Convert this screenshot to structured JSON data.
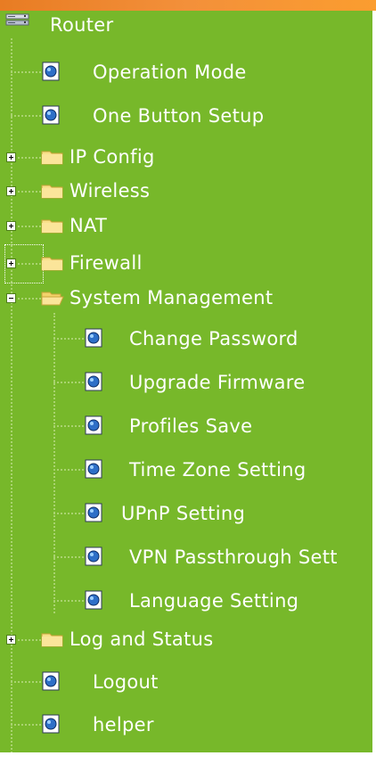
{
  "tree": {
    "root": {
      "label": "Router",
      "icon": "router-icon"
    },
    "items": [
      {
        "label": "Operation Mode",
        "type": "page"
      },
      {
        "label": "One Button Setup",
        "type": "page"
      },
      {
        "label": "IP Config",
        "type": "folder",
        "expanded": false
      },
      {
        "label": "Wireless",
        "type": "folder",
        "expanded": false
      },
      {
        "label": "NAT",
        "type": "folder",
        "expanded": false
      },
      {
        "label": "Firewall",
        "type": "folder",
        "expanded": false
      },
      {
        "label": "System Management",
        "type": "folder",
        "expanded": true
      },
      {
        "label": "Change Password",
        "type": "page"
      },
      {
        "label": "Upgrade Firmware",
        "type": "page"
      },
      {
        "label": "Profiles Save",
        "type": "page"
      },
      {
        "label": "Time Zone Setting",
        "type": "page"
      },
      {
        "label": "UPnP Setting",
        "type": "page"
      },
      {
        "label": "VPN Passthrough Sett",
        "type": "page"
      },
      {
        "label": "Language Setting",
        "type": "page"
      },
      {
        "label": "Log and Status",
        "type": "folder",
        "expanded": false
      },
      {
        "label": "Logout",
        "type": "page"
      },
      {
        "label": "helper",
        "type": "page"
      }
    ]
  },
  "colors": {
    "panel_background": "#77b82a",
    "top_bar": "#f08a2e",
    "text": "#ffffff"
  }
}
